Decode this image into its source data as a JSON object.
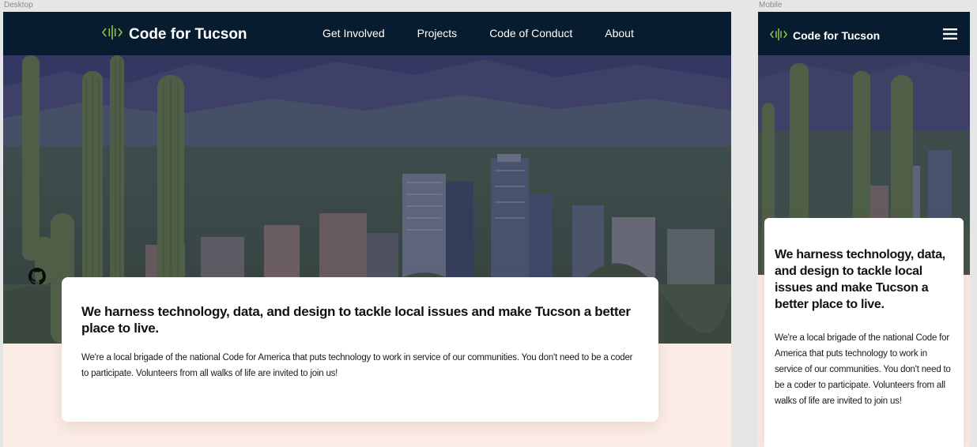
{
  "frames": {
    "desktop_label": "Desktop",
    "mobile_label": "Mobile"
  },
  "brand": {
    "name": "Code for Tucson",
    "logo_icon": "code-brackets-logo-icon",
    "accent_color": "#8dc63f",
    "nav_bg": "#071c2e"
  },
  "nav": {
    "links": [
      "Get Involved",
      "Projects",
      "Code of Conduct",
      "About"
    ],
    "menu_icon": "hamburger-menu-icon"
  },
  "hero": {
    "heading": "We harness technology, data, and design to tackle local issues and make Tucson a better place to live.",
    "body": "We're a local brigade of the national Code for America that puts technology to work in service of our communities. You don't need to be a coder to participate. Volunteers from all walks of life are invited to join us!",
    "social_icon": "github-icon"
  },
  "colors": {
    "page_bg": "#fcece6",
    "card_bg": "#ffffff"
  }
}
